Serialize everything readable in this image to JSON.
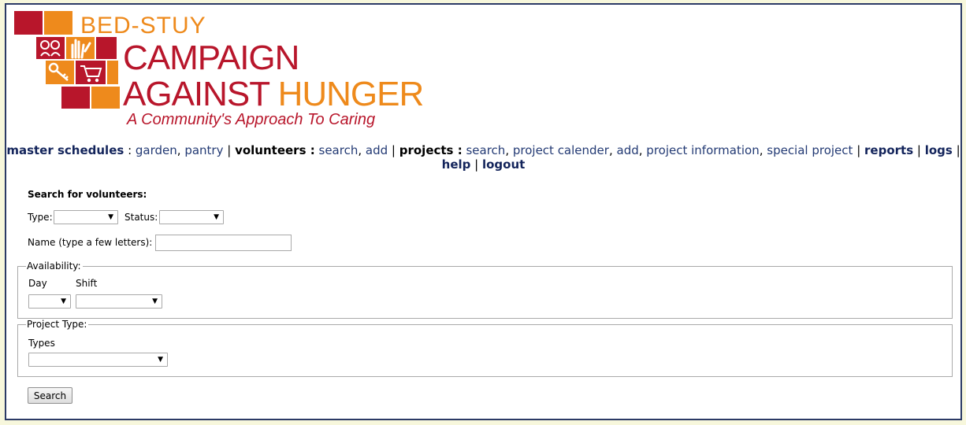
{
  "logo": {
    "line1": "BED-STUY",
    "line2": "CAMPAIGN",
    "line3_red": "AGAINST",
    "line3_orange": "HUNGER",
    "tagline": "A Community's Approach To Caring",
    "colors": {
      "red": "#b8162b",
      "orange": "#ee8a1c"
    }
  },
  "nav": {
    "master_schedules": "master schedules",
    "master_items": [
      "garden",
      "pantry"
    ],
    "volunteers": "volunteers :",
    "volunteer_items": [
      "search",
      "add"
    ],
    "projects": "projects :",
    "project_items": [
      "search",
      "project calender",
      "add",
      "project information",
      "special project"
    ],
    "reports": "reports",
    "logs": "logs",
    "help": "help",
    "logout": "logout"
  },
  "search": {
    "heading": "Search for volunteers:",
    "type_label": "Type:",
    "type_value": "",
    "status_label": "Status:",
    "status_value": "",
    "name_label": "Name (type a few letters):",
    "name_value": "",
    "availability_legend": "Availability:",
    "day_label": "Day",
    "day_value": "",
    "shift_label": "Shift",
    "shift_value": "",
    "project_type_legend": "Project Type:",
    "types_label": "Types",
    "types_value": "",
    "button_label": "Search"
  },
  "icons": {
    "dropdown": "dropdown-arrow-icon"
  }
}
